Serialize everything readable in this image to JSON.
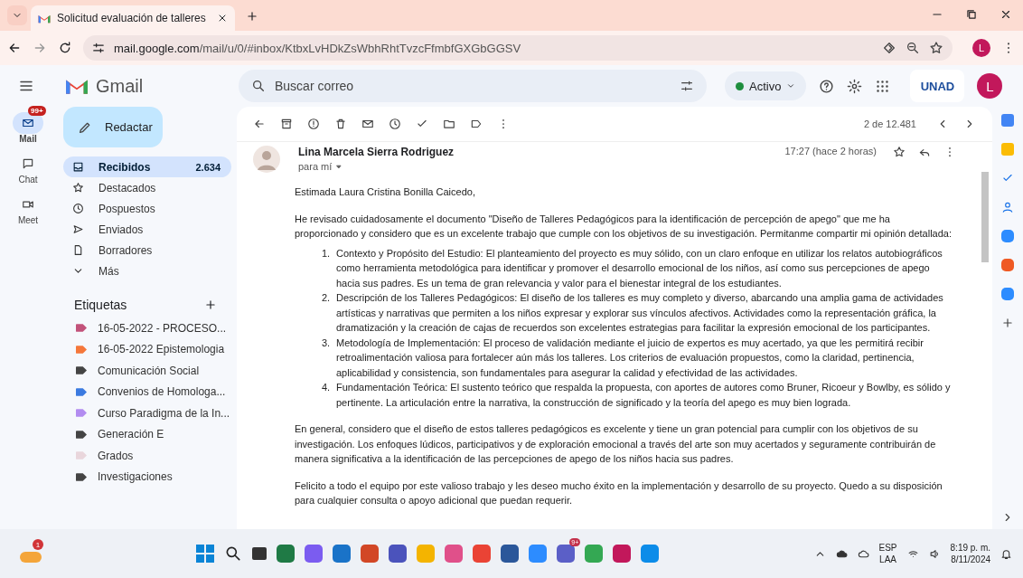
{
  "browser": {
    "tab_title": "Solicitud evaluación de talleres",
    "url_host": "mail.google.com",
    "url_path": "/mail/u/0/#inbox/KtbxLvHDkZsWbhRhtTvzcFfmbfGXGbGGSV",
    "profile_initial": "L"
  },
  "gmail": {
    "brand": "Gmail",
    "search_placeholder": "Buscar correo",
    "status": "Activo",
    "avatar_initial": "L",
    "org_logo": "UNAD",
    "rail": [
      {
        "label": "Mail",
        "badge": "99+",
        "selected": true
      },
      {
        "label": "Chat",
        "selected": false
      },
      {
        "label": "Meet",
        "selected": false
      }
    ],
    "compose": "Redactar",
    "folders": [
      {
        "label": "Recibidos",
        "count": "2.634",
        "selected": true
      },
      {
        "label": "Destacados",
        "selected": false
      },
      {
        "label": "Pospuestos",
        "selected": false
      },
      {
        "label": "Enviados",
        "selected": false
      },
      {
        "label": "Borradores",
        "selected": false
      },
      {
        "label": "Más",
        "selected": false
      }
    ],
    "labels_heading": "Etiquetas",
    "labels": [
      {
        "label": "16-05-2022 - PROCESO...",
        "color": "#c2527a"
      },
      {
        "label": "16-05-2022 Epistemologia",
        "color": "#f5773a"
      },
      {
        "label": "Comunicación Social",
        "color": "#444444"
      },
      {
        "label": "Convenios de Homologa...",
        "color": "#3b7ae0"
      },
      {
        "label": "Curso Paradigma de la In...",
        "color": "#b28cf0"
      },
      {
        "label": "Generación E",
        "color": "#444444"
      },
      {
        "label": "Grados",
        "color": "#e9d6dc"
      },
      {
        "label": "Investigaciones",
        "color": "#444444"
      }
    ],
    "pager": "2 de 12.481",
    "message": {
      "sender": "Lina Marcela Sierra Rodriguez",
      "recipient": "para mí",
      "time": "17:27 (hace 2 horas)",
      "greeting": "Estimada Laura Cristina Bonilla Caicedo,",
      "intro": "He revisado cuidadosamente el documento \"Diseño de Talleres Pedagógicos para la identificación de percepción de apego\" que me ha proporcionado y considero que es un excelente trabajo que cumple con los objetivos de su investigación. Permitanme compartir mi opinión detallada:",
      "points": [
        {
          "number": "1.",
          "text": "Contexto y Propósito del Estudio: El planteamiento del proyecto es muy sólido, con un claro enfoque en utilizar los relatos autobiográficos como herramienta metodológica para identificar y promover el desarrollo emocional de los niños, así como sus percepciones de apego hacia sus padres. Es un tema de gran relevancia y valor para el bienestar integral de los estudiantes."
        },
        {
          "number": "2.",
          "text": "Descripción de los Talleres Pedagógicos: El diseño de los talleres es muy completo y diverso, abarcando una amplia gama de actividades artísticas y narrativas que permiten a los niños expresar y explorar sus vínculos afectivos. Actividades como la representación gráfica, la dramatización y la creación de cajas de recuerdos son excelentes estrategias para facilitar la expresión emocional de los participantes."
        },
        {
          "number": "3.",
          "text": "Metodología de Implementación: El proceso de validación mediante el juicio de expertos es muy acertado, ya que les permitirá recibir retroalimentación valiosa para fortalecer aún más los talleres. Los criterios de evaluación propuestos, como la claridad, pertinencia, aplicabilidad y consistencia, son fundamentales para asegurar la calidad y efectividad de las actividades."
        },
        {
          "number": "4.",
          "text": "Fundamentación Teórica: El sustento teórico que respalda la propuesta, con aportes de autores como Bruner, Ricoeur y Bowlby, es sólido y pertinente. La articulación entre la narrativa, la construcción de significado y la teoría del apego es muy bien lograda."
        }
      ],
      "paragraphs": [
        "En general, considero que el diseño de estos talleres pedagógicos es excelente y tiene un gran potencial para cumplir con los objetivos de su investigación. Los enfoques lúdicos, participativos y de exploración emocional a través del arte son muy acertados y seguramente contribuirán de manera significativa a la identificación de las percepciones de apego de los niños hacia sus padres.",
        "Felicito a todo el equipo por este valioso trabajo y les deseo mucho éxito en la implementación y desarrollo de su proyecto. Quedo a su disposición para cualquier consulta o apoyo adicional que puedan requerir."
      ]
    }
  },
  "taskbar": {
    "weather_badge": "1",
    "apps": [
      {
        "color": "#1f7a45"
      },
      {
        "color": "#7b5cf0"
      },
      {
        "color": "#1a73c8"
      },
      {
        "color": "#d24726"
      },
      {
        "color": "#4b53bc"
      },
      {
        "color": "#f4b400"
      },
      {
        "color": "#e0508a"
      },
      {
        "color": "#ea4335"
      },
      {
        "color": "#2b579a"
      },
      {
        "color": "#2d8cff"
      },
      {
        "color": "#5b5fc7",
        "badge": "9+"
      },
      {
        "color": "#34a853"
      },
      {
        "color": "#c2185b"
      },
      {
        "color": "#0c8ce9"
      }
    ],
    "language": "ESP",
    "layout": "LAA",
    "time": "8:19 p. m.",
    "date": "8/11/2024"
  }
}
